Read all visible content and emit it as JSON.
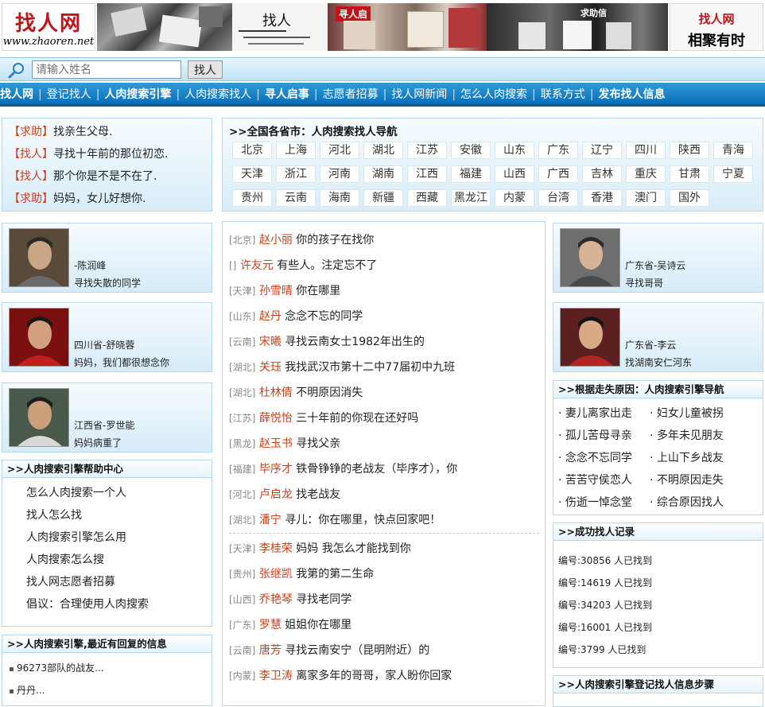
{
  "banner": {
    "logo_cn": "找人网",
    "logo_url": "www.zhaoren.net",
    "collage_texts": [
      "找人",
      "寻人启",
      "求助信"
    ],
    "tagline_top": "找人网",
    "tagline_bottom": "相聚有时"
  },
  "search": {
    "placeholder": "请输入姓名",
    "button_label": "找人"
  },
  "nav": [
    {
      "label": "找人网",
      "bold": true
    },
    {
      "label": "登记找人",
      "bold": false
    },
    {
      "label": "人肉搜索引擎",
      "bold": true
    },
    {
      "label": "人肉搜索找人",
      "bold": false
    },
    {
      "label": "寻人启事",
      "bold": true
    },
    {
      "label": "志愿者招募",
      "bold": false
    },
    {
      "label": "找人网新闻",
      "bold": false
    },
    {
      "label": "怎么人肉搜索",
      "bold": false
    },
    {
      "label": "联系方式",
      "bold": false
    },
    {
      "label": "发布找人信息",
      "bold": true
    }
  ],
  "help_posts": [
    {
      "tag": "【求助】",
      "text": "找亲生父母."
    },
    {
      "tag": "【找人】",
      "text": "寻找十年前的那位初恋."
    },
    {
      "tag": "【找人】",
      "text": "那个你是不是不在了."
    },
    {
      "tag": "【求助】",
      "text": "妈妈，女儿好想你."
    }
  ],
  "region_nav": {
    "title": ">>全国各省市：人肉搜索找人导航",
    "regions": [
      "北京",
      "上海",
      "河北",
      "湖北",
      "江苏",
      "安徽",
      "山东",
      "广东",
      "辽宁",
      "四川",
      "陕西",
      "青海",
      "天津",
      "浙江",
      "河南",
      "湖南",
      "江西",
      "福建",
      "山西",
      "广西",
      "吉林",
      "重庆",
      "甘肃",
      "宁夏",
      "贵州",
      "云南",
      "海南",
      "新疆",
      "西藏",
      "黑龙江",
      "内蒙",
      "台湾",
      "香港",
      "澳门",
      "国外"
    ]
  },
  "left_cards": [
    {
      "name": "-陈润峰",
      "message": "寻找失散的同学"
    },
    {
      "name": "四川省-舒晓蓉",
      "message": "妈妈，我们都很想念你"
    },
    {
      "name": "江西省-罗世能",
      "message": "妈妈病重了"
    }
  ],
  "right_cards": [
    {
      "name": "广东省-吴诗云",
      "message": "寻找哥哥"
    },
    {
      "name": "广东省-李云",
      "message": "找湖南安仁河东"
    }
  ],
  "center_list": [
    {
      "region": "[北京]",
      "name": "赵小丽",
      "text": "你的孩子在找你"
    },
    {
      "region": "[]",
      "name": "许友元",
      "text": "有些人。注定忘不了"
    },
    {
      "region": "[天津]",
      "name": "孙雪晴",
      "text": "你在哪里"
    },
    {
      "region": "[山东]",
      "name": "赵丹",
      "text": "念念不忘的同学"
    },
    {
      "region": "[云南]",
      "name": "宋曦",
      "text": "寻找云南女士1982年出生的"
    },
    {
      "region": "[湖北]",
      "name": "关珏",
      "text": "我找武汉市第十二中77届初中九班"
    },
    {
      "region": "[湖北]",
      "name": "杜林倩",
      "text": "不明原因消失"
    },
    {
      "region": "[江苏]",
      "name": "薛悦怡",
      "text": "三十年前的你现在还好吗"
    },
    {
      "region": "[黑龙]",
      "name": "赵玉书",
      "text": "寻找父亲"
    },
    {
      "region": "[福建]",
      "name": "毕序才",
      "text": "铁骨铮铮的老战友（毕序才），你"
    },
    {
      "region": "[河北]",
      "name": "卢启龙",
      "text": "找老战友"
    },
    {
      "region": "[湖北]",
      "name": "潘宁",
      "text": "寻儿：你在哪里，快点回家吧！"
    },
    {
      "region": "[天津]",
      "name": "李桂荣",
      "text": "妈妈 我怎么才能找到你"
    },
    {
      "region": "[贵州]",
      "name": "张继凯",
      "text": "我第的第二生命"
    },
    {
      "region": "[山西]",
      "name": "乔艳琴",
      "text": "寻找老同学"
    },
    {
      "region": "[广东]",
      "name": "罗慧",
      "text": "姐姐你在哪里"
    },
    {
      "region": "[云南]",
      "name": "唐芳",
      "text": "寻找云南安宁（昆明附近）的"
    },
    {
      "region": "[内蒙]",
      "name": "李卫涛",
      "text": "离家多年的哥哥，家人盼你回家"
    }
  ],
  "help_center": {
    "title": ">>人肉搜索引擎帮助中心",
    "links": [
      "怎么人肉搜索一个人",
      "找人怎么找",
      "人肉搜索引擎怎么用",
      "人肉搜索怎么搜",
      "找人网志愿者招募",
      "倡议：合理使用人肉搜索"
    ]
  },
  "replied": {
    "title": ">>人肉搜索引擎,最近有回复的信息",
    "items": [
      "96273部队的战友...",
      "丹丹..."
    ]
  },
  "reasons": {
    "title": ">>根据走失原因：人肉搜索引擎导航",
    "items": [
      "妻儿离家出走",
      "妇女儿童被拐",
      "孤儿苦母寻亲",
      "多年未见朋友",
      "念念不忘同学",
      "上山下乡战友",
      "苦苦守侯恋人",
      "不明原因走失",
      "伤逝一悼念堂",
      "综合原因找人"
    ]
  },
  "success": {
    "title": ">>成功找人记录",
    "items": [
      "编号:30856 人已找到",
      "编号:14619 人已找到",
      "编号:34203 人已找到",
      "编号:16001 人已找到",
      "编号:3799 人已找到"
    ]
  },
  "register_steps": {
    "title": ">>人肉搜索引擎登记找人信息步骤"
  }
}
